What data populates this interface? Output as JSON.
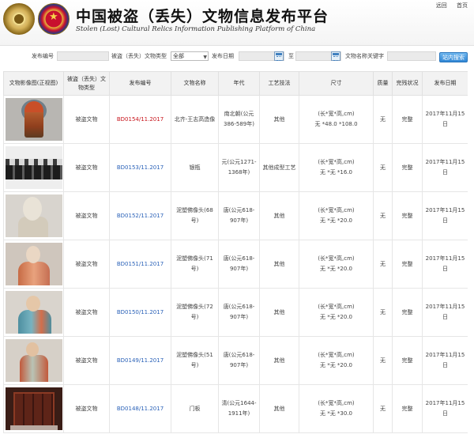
{
  "header": {
    "site_title": "中国被盗（丢失）文物信息发布平台",
    "site_subtitle": "Stolen (Lost) Cultural Relics Information Publishing Platform of China",
    "links": [
      "远回",
      "首页"
    ]
  },
  "search": {
    "number_label": "发布编号",
    "type_label": "被盗（丢失）文物类型",
    "type_value": "全部",
    "date_label": "发布日期",
    "to_label": "至",
    "keyword_label": "文物名称关键字",
    "button_label": "站内搜索"
  },
  "table": {
    "columns": [
      "文物影像图(正视图)",
      "被盗（丢失）文物类型",
      "发布编号",
      "文物名称",
      "年代",
      "工艺技法",
      "尺寸",
      "质量",
      "完残状况",
      "发布日期"
    ],
    "rows": [
      {
        "type": "被盗文物",
        "number": "BD0154/11.2017",
        "name": "北齐-王志高造像",
        "era": "南北朝(公元386-589年)",
        "craft": "其他",
        "size": "(长*宽*高,cm)\n无 *48.0 *108.0",
        "mass": "无",
        "condition": "完整",
        "date": "2017年11月15日"
      },
      {
        "type": "被盗文物",
        "number": "BD0153/11.2017",
        "name": "银瓶",
        "era": "元(公元1271-1368年)",
        "craft": "其他成型工艺",
        "size": "(长*宽*高,cm)\n无 *无 *16.0",
        "mass": "无",
        "condition": "完整",
        "date": "2017年11月15日"
      },
      {
        "type": "被盗文物",
        "number": "BD0152/11.2017",
        "name": "泥塑佛像头(68号)",
        "era": "唐(公元618-907年)",
        "craft": "其他",
        "size": "(长*宽*高,cm)\n无 *无 *20.0",
        "mass": "无",
        "condition": "完整",
        "date": "2017年11月15日"
      },
      {
        "type": "被盗文物",
        "number": "BD0151/11.2017",
        "name": "泥塑佛像头(71号)",
        "era": "唐(公元618-907年)",
        "craft": "其他",
        "size": "(长*宽*高,cm)\n无 *无 *20.0",
        "mass": "无",
        "condition": "完整",
        "date": "2017年11月15日"
      },
      {
        "type": "被盗文物",
        "number": "BD0150/11.2017",
        "name": "泥塑佛像头(72号)",
        "era": "唐(公元618-907年)",
        "craft": "其他",
        "size": "(长*宽*高,cm)\n无 *无 *20.0",
        "mass": "无",
        "condition": "完整",
        "date": "2017年11月15日"
      },
      {
        "type": "被盗文物",
        "number": "BD0149/11.2017",
        "name": "泥塑佛像头(51号)",
        "era": "唐(公元618-907年)",
        "craft": "其他",
        "size": "(长*宽*高,cm)\n无 *无 *20.0",
        "mass": "无",
        "condition": "完整",
        "date": "2017年11月15日"
      },
      {
        "type": "被盗文物",
        "number": "BD0148/11.2017",
        "name": "门板",
        "era": "清(公元1644-1911年)",
        "craft": "其他",
        "size": "(长*宽*高,cm)\n无 *无 *30.0",
        "mass": "无",
        "condition": "完整",
        "date": "2017年11月15日"
      }
    ]
  },
  "colors": {
    "link": "#2b62b8",
    "link_highlight": "#c8161d",
    "button": "#2f86d4"
  }
}
